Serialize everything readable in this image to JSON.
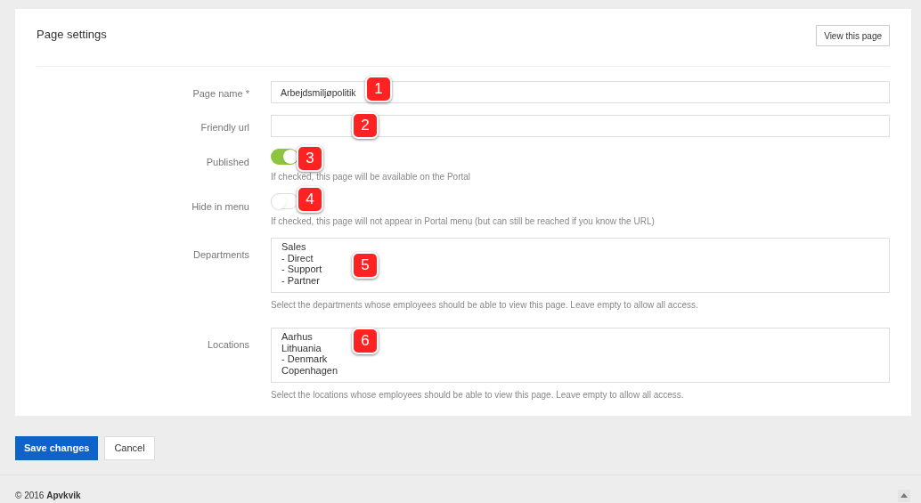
{
  "panel": {
    "title": "Page settings",
    "view_button": "View this page"
  },
  "fields": [
    {
      "kind": "text",
      "label": "Page name *",
      "value": "Arbejdsmiljøpolitik"
    },
    {
      "kind": "text",
      "label": "Friendly url"
    },
    {
      "kind": "toggle",
      "label": "Published",
      "on": true,
      "help": "If checked, this page will be available on the Portal"
    },
    {
      "kind": "toggle",
      "label": "Hide in menu",
      "on": false,
      "help": "If checked, this page will not appear in Portal menu (but can still be reached if you know the URL)"
    },
    {
      "kind": "list",
      "label": "Departments",
      "options": [
        "Sales",
        "- Direct",
        "- Support",
        "- Partner"
      ],
      "help": "Select the departments whose employees should be able to view this page. Leave empty to allow all access."
    },
    {
      "kind": "list",
      "label": "Locations",
      "options": [
        "Aarhus",
        "Lithuania",
        "- Denmark",
        "Copenhagen"
      ],
      "help": "Select the locations whose employees should be able to view this page. Leave empty to allow all access."
    }
  ],
  "callouts": [
    "1",
    "2",
    "3",
    "4",
    "5",
    "6"
  ],
  "actions": {
    "save": "Save changes",
    "cancel": "Cancel"
  },
  "footer": {
    "copyright": "© 2016",
    "brand": "Apvkvik"
  }
}
